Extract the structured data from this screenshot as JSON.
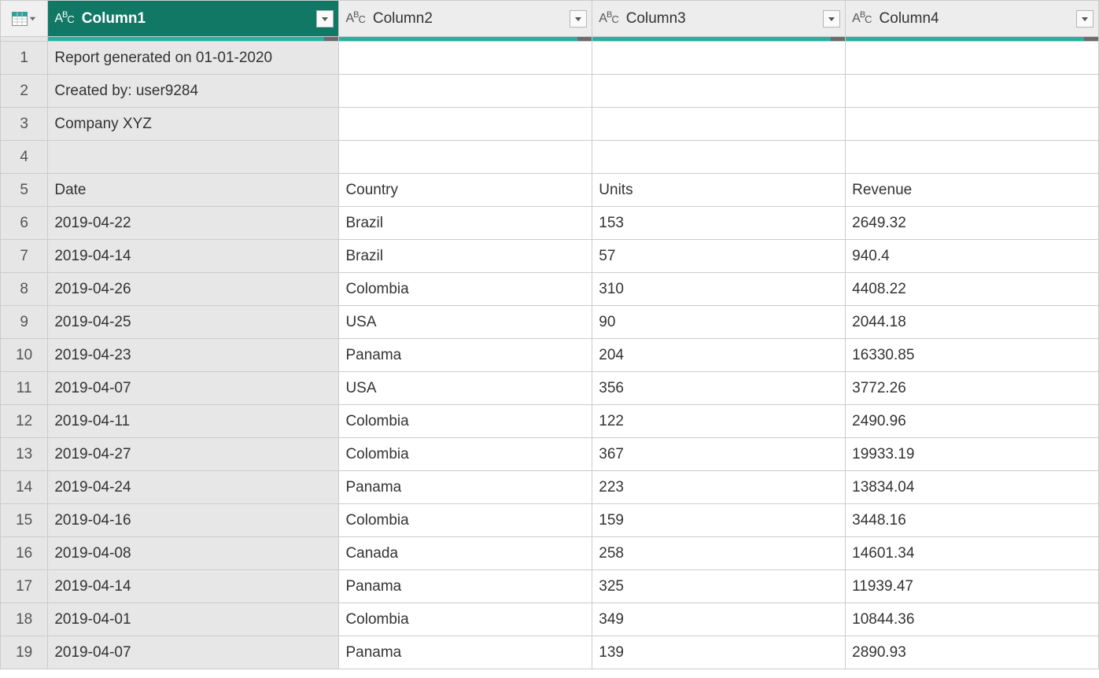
{
  "columns": [
    {
      "name": "Column1",
      "type": "ABC",
      "selected": true
    },
    {
      "name": "Column2",
      "type": "ABC",
      "selected": false
    },
    {
      "name": "Column3",
      "type": "ABC",
      "selected": false
    },
    {
      "name": "Column4",
      "type": "ABC",
      "selected": false
    }
  ],
  "rows": [
    {
      "n": "1",
      "c": [
        "Report generated on 01-01-2020",
        "",
        "",
        ""
      ]
    },
    {
      "n": "2",
      "c": [
        "Created by: user9284",
        "",
        "",
        ""
      ]
    },
    {
      "n": "3",
      "c": [
        "Company XYZ",
        "",
        "",
        ""
      ]
    },
    {
      "n": "4",
      "c": [
        "",
        "",
        "",
        ""
      ]
    },
    {
      "n": "5",
      "c": [
        "Date",
        "Country",
        "Units",
        "Revenue"
      ]
    },
    {
      "n": "6",
      "c": [
        "2019-04-22",
        "Brazil",
        "153",
        "2649.32"
      ]
    },
    {
      "n": "7",
      "c": [
        "2019-04-14",
        "Brazil",
        "57",
        "940.4"
      ]
    },
    {
      "n": "8",
      "c": [
        "2019-04-26",
        "Colombia",
        "310",
        "4408.22"
      ]
    },
    {
      "n": "9",
      "c": [
        "2019-04-25",
        "USA",
        "90",
        "2044.18"
      ]
    },
    {
      "n": "10",
      "c": [
        "2019-04-23",
        "Panama",
        "204",
        "16330.85"
      ]
    },
    {
      "n": "11",
      "c": [
        "2019-04-07",
        "USA",
        "356",
        "3772.26"
      ]
    },
    {
      "n": "12",
      "c": [
        "2019-04-11",
        "Colombia",
        "122",
        "2490.96"
      ]
    },
    {
      "n": "13",
      "c": [
        "2019-04-27",
        "Colombia",
        "367",
        "19933.19"
      ]
    },
    {
      "n": "14",
      "c": [
        "2019-04-24",
        "Panama",
        "223",
        "13834.04"
      ]
    },
    {
      "n": "15",
      "c": [
        "2019-04-16",
        "Colombia",
        "159",
        "3448.16"
      ]
    },
    {
      "n": "16",
      "c": [
        "2019-04-08",
        "Canada",
        "258",
        "14601.34"
      ]
    },
    {
      "n": "17",
      "c": [
        "2019-04-14",
        "Panama",
        "325",
        "11939.47"
      ]
    },
    {
      "n": "18",
      "c": [
        "2019-04-01",
        "Colombia",
        "349",
        "10844.36"
      ]
    },
    {
      "n": "19",
      "c": [
        "2019-04-07",
        "Panama",
        "139",
        "2890.93"
      ]
    }
  ]
}
